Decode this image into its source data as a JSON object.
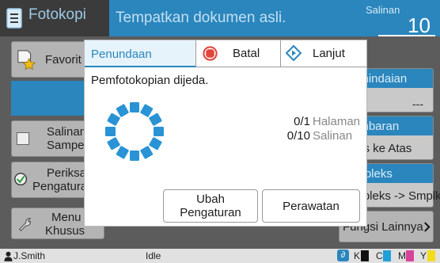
{
  "header": {
    "mode_title": "Fotokopi",
    "message": "Tempatkan dokumen asli.",
    "copies_label": "Salinan",
    "copies_value": "10"
  },
  "left_buttons": [
    {
      "label": "Favorit"
    },
    {
      "label1": "Salinan",
      "label2": "Sampel"
    },
    {
      "label1": "Periksa",
      "label2": "Pengaturan"
    },
    {
      "label1": "Menu",
      "label2": "Khusus"
    }
  ],
  "right_buttons": [
    {
      "title": "Pemindaian",
      "value": "---"
    },
    {
      "title": "Pembaran",
      "value": "Atas ke Atas"
    },
    {
      "title": "Simpleks",
      "value": "Simpleks -> Smplks"
    },
    {
      "label": "Fungsi Lainnya"
    }
  ],
  "dialog": {
    "tab_active": "Penundaan",
    "cancel_label": "Batal",
    "next_label": "Lanjut",
    "status_message": "Pemfotokopian dijeda.",
    "pages_count": "0/1",
    "pages_unit": "Halaman",
    "copies_count": "0/10",
    "copies_unit": "Salinan",
    "change_settings_line1": "Ubah",
    "change_settings_line2": "Pengaturan",
    "maintenance_label": "Perawatan"
  },
  "footer": {
    "user": "J.Smith",
    "status": "Idle",
    "inks": [
      "K",
      "C",
      "M",
      "Y"
    ]
  },
  "colors": {
    "accent": "#2a86bd",
    "spinner": "#2a93d5",
    "cancel_red": "#e0463d",
    "ink_k": "#111111",
    "ink_c": "#1ea0d8",
    "ink_m": "#d8439a",
    "ink_y": "#f2dc1c"
  }
}
